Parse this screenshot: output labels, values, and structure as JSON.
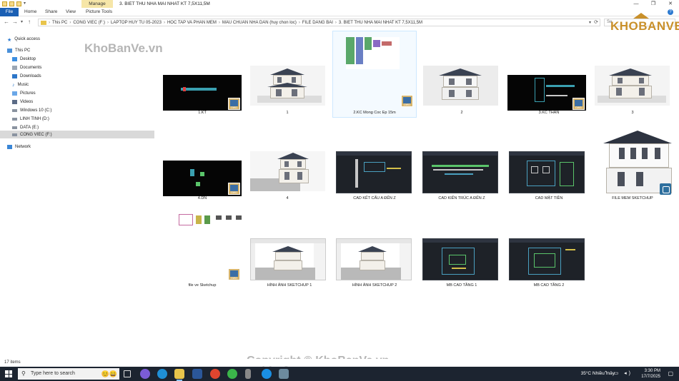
{
  "window": {
    "manage_tab": "Manage",
    "title": "3. BIET THU NHA MAI NHAT KT 7,5X11,5M",
    "controls": [
      "—",
      "❐",
      "✕"
    ]
  },
  "ribbon": {
    "tabs": [
      "File",
      "Home",
      "Share",
      "View",
      "Picture Tools"
    ],
    "help": "?"
  },
  "address": {
    "crumbs": [
      "This PC",
      "CONG VIEC (F:)",
      "LAPTOP HUY TU 05-2023",
      "HOC TAP VA PHAN MEM",
      "MAU CHUAN NHA DAN (huy chon loc)",
      "FILE DANG BAI",
      "3. BIET THU NHA MAI NHAT KT 7,5X11,5M"
    ],
    "search_placeholder": "Se"
  },
  "sidebar": {
    "items": [
      {
        "label": "Quick access",
        "icon": "star-icon"
      },
      {
        "label": "This PC",
        "icon": "computer-icon"
      },
      {
        "label": "Desktop",
        "icon": "desktop-icon"
      },
      {
        "label": "Documents",
        "icon": "documents-icon"
      },
      {
        "label": "Downloads",
        "icon": "downloads-icon"
      },
      {
        "label": "Music",
        "icon": "music-icon"
      },
      {
        "label": "Pictures",
        "icon": "pictures-icon"
      },
      {
        "label": "Videos",
        "icon": "videos-icon"
      },
      {
        "label": "Windows 10 (C:)",
        "icon": "drive-icon"
      },
      {
        "label": "LINH TINH (D:)",
        "icon": "drive-icon"
      },
      {
        "label": "DATA (E:)",
        "icon": "drive-icon"
      },
      {
        "label": "CONG VIEC (F:)",
        "icon": "drive-icon"
      },
      {
        "label": "Network",
        "icon": "network-icon"
      }
    ]
  },
  "files": [
    {
      "name": "1.KT",
      "kind": "dwg-dark"
    },
    {
      "name": "1",
      "kind": "render"
    },
    {
      "name": "2.KC Mong Coc Ep 15m",
      "kind": "dwg-white"
    },
    {
      "name": "2",
      "kind": "render"
    },
    {
      "name": "3.KC THAN",
      "kind": "dwg-dark"
    },
    {
      "name": "3",
      "kind": "render"
    },
    {
      "name": "4.DN",
      "kind": "dwg-dark"
    },
    {
      "name": "4",
      "kind": "render"
    },
    {
      "name": "CAD KẾT CẤU A ĐẾN Z",
      "kind": "cad"
    },
    {
      "name": "CAD KIẾN TRÚC A ĐẾN Z",
      "kind": "cad"
    },
    {
      "name": "CAD MẶT TIỀN",
      "kind": "cad"
    },
    {
      "name": "FILE MEM SKETCHUP",
      "kind": "skp"
    },
    {
      "name": "file ve Sketchup",
      "kind": "dwg-white"
    },
    {
      "name": "HÌNH ẢNH SKETCHUP 1",
      "kind": "screen"
    },
    {
      "name": "HÌNH ẢNH SKETCHUP 2",
      "kind": "screen"
    },
    {
      "name": "MB CAD TẦNG 1",
      "kind": "cad"
    },
    {
      "name": "MB CAD TẦNG 2",
      "kind": "cad"
    }
  ],
  "status": {
    "count": "17 items"
  },
  "taskbar": {
    "search_placeholder": "Type here to search",
    "weather": "35°C  Nhiều mây",
    "time": "3:30 PM",
    "date": "17/7/2025"
  },
  "watermarks": {
    "top": "KhoBanVe.vn",
    "bottom": "Copyright © KhoBanVe.vn",
    "logo": "KHOBANVE"
  },
  "colors": {
    "accent": "#1a5fb4",
    "taskbar": "#1c2430",
    "logo": "#c9902a"
  }
}
